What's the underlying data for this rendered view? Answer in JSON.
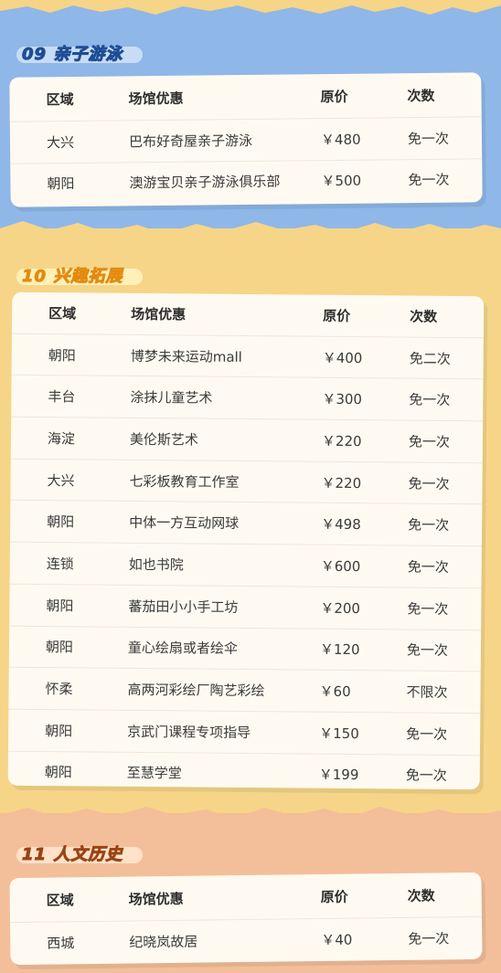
{
  "colors": {
    "blue": "#8fb7e8",
    "yellow": "#f6d588",
    "peach": "#f3bf9a",
    "card": "#fffaf1"
  },
  "headers": {
    "region": "区域",
    "venue": "场馆优惠",
    "price": "原价",
    "times": "次数"
  },
  "sections": [
    {
      "title": "09 亲子游泳",
      "rows": [
        {
          "region": "大兴",
          "venue": "巴布好奇屋亲子游泳",
          "price": "￥480",
          "times": "免一次"
        },
        {
          "region": "朝阳",
          "venue": "澳游宝贝亲子游泳俱乐部",
          "price": "￥500",
          "times": "免一次"
        }
      ]
    },
    {
      "title": "10 兴趣拓展",
      "rows": [
        {
          "region": "朝阳",
          "venue": "博梦未来运动mall",
          "price": "￥400",
          "times": "免二次"
        },
        {
          "region": "丰台",
          "venue": "涂抹儿童艺术",
          "price": "￥300",
          "times": "免一次"
        },
        {
          "region": "海淀",
          "venue": "美伦斯艺术",
          "price": "￥220",
          "times": "免一次"
        },
        {
          "region": "大兴",
          "venue": "七彩板教育工作室",
          "price": "￥220",
          "times": "免一次"
        },
        {
          "region": "朝阳",
          "venue": "中体一方互动网球",
          "price": "￥498",
          "times": "免一次"
        },
        {
          "region": "连锁",
          "venue": "如也书院",
          "price": "￥600",
          "times": "免一次"
        },
        {
          "region": "朝阳",
          "venue": "蕃茄田小小手工坊",
          "price": "￥200",
          "times": "免一次"
        },
        {
          "region": "朝阳",
          "venue": "童心绘扇或者绘伞",
          "price": "￥120",
          "times": "免一次"
        },
        {
          "region": "怀柔",
          "venue": "高两河彩绘厂陶艺彩绘",
          "price": "￥60",
          "times": "不限次"
        },
        {
          "region": "朝阳",
          "venue": "京武门课程专项指导",
          "price": "￥150",
          "times": "免一次"
        },
        {
          "region": "朝阳",
          "venue": "至慧学堂",
          "price": "￥199",
          "times": "免一次"
        }
      ]
    },
    {
      "title": "11 人文历史",
      "rows": [
        {
          "region": "西城",
          "venue": "纪晓岚故居",
          "price": "￥40",
          "times": "免一次"
        }
      ]
    }
  ]
}
